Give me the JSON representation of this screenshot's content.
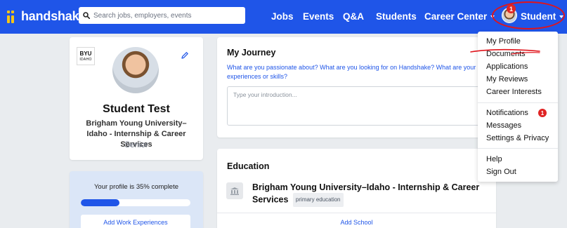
{
  "brand": {
    "name": "handshake",
    "accent": "#1f55e8",
    "logo_color": "#f5c518"
  },
  "search": {
    "placeholder": "Search jobs, employers, events"
  },
  "nav": {
    "jobs": "Jobs",
    "events": "Events",
    "qa": "Q&A",
    "students": "Students",
    "career_center": "Career Center",
    "student": "Student",
    "notification_count": "1"
  },
  "profile": {
    "school_logo_top": "BYU",
    "school_logo_bottom": "IDAHO",
    "name": "Student Test",
    "school": "Brigham Young University–Idaho - Internship & Career Services",
    "year": "Senior",
    "edit_icon": "pencil-icon"
  },
  "progress": {
    "text": "Your profile is 35% complete",
    "percent": 35,
    "add_work_label": "Add Work Experiences"
  },
  "journey": {
    "title": "My Journey",
    "question": "What are you passionate about? What are you looking for on Handshake? What are your experiences or skills?",
    "placeholder": "Type your introduction..."
  },
  "education": {
    "title": "Education",
    "school": "Brigham Young University–Idaho - Internship & Career Services",
    "tag": "primary education",
    "add_label": "Add School",
    "icon": "building-icon"
  },
  "dropdown": {
    "my_profile": "My Profile",
    "documents": "Documents",
    "applications": "Applications",
    "my_reviews": "My Reviews",
    "career_interests": "Career Interests",
    "notifications": "Notifications",
    "notifications_count": "1",
    "messages": "Messages",
    "settings": "Settings & Privacy",
    "help": "Help",
    "sign_out": "Sign Out"
  },
  "annotations": {
    "color": "#e0141b"
  }
}
